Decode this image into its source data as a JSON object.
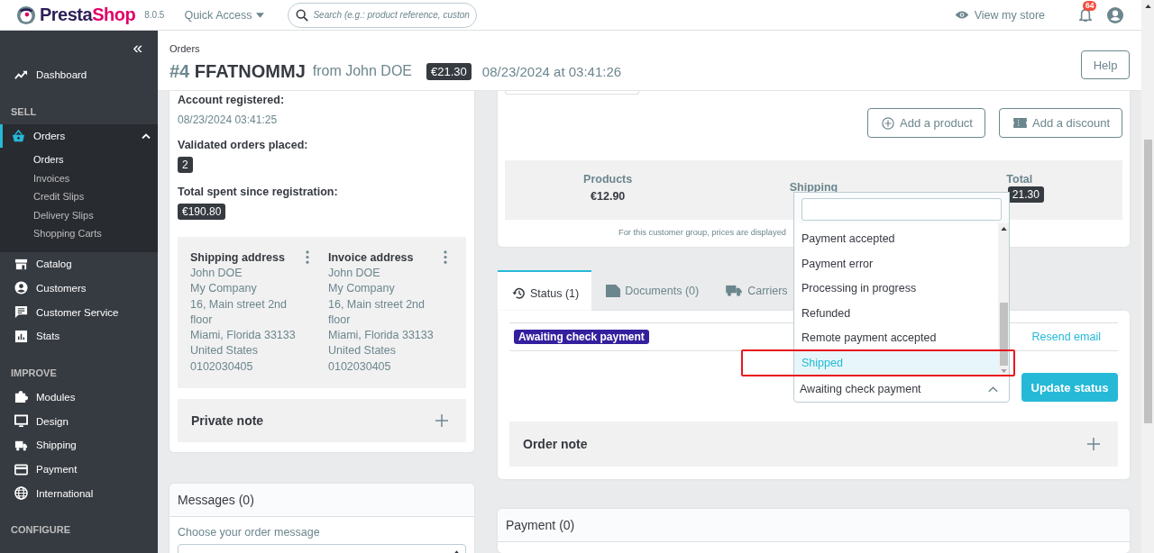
{
  "header": {
    "brand": {
      "first": "Presta",
      "second": "Shop"
    },
    "version": "8.0.5",
    "quick_access": "Quick Access",
    "search": {
      "placeholder": "Search (e.g.: product reference, custon"
    },
    "view_store": "View my store",
    "notifications": "64"
  },
  "sidebar": {
    "collapse": "«",
    "items": [
      {
        "kind": "link",
        "label": "Dashboard",
        "selected": false
      },
      {
        "kind": "heading",
        "label": "SELL"
      },
      {
        "kind": "link",
        "label": "Orders",
        "selected": true,
        "expanded": true,
        "children": [
          {
            "label": "Orders",
            "selected": true
          },
          {
            "label": "Invoices",
            "selected": false
          },
          {
            "label": "Credit Slips",
            "selected": false
          },
          {
            "label": "Delivery Slips",
            "selected": false
          },
          {
            "label": "Shopping Carts",
            "selected": false
          }
        ]
      },
      {
        "kind": "link",
        "label": "Catalog",
        "selected": false
      },
      {
        "kind": "link",
        "label": "Customers",
        "selected": false
      },
      {
        "kind": "link",
        "label": "Customer Service",
        "selected": false
      },
      {
        "kind": "link",
        "label": "Stats",
        "selected": false
      },
      {
        "kind": "heading",
        "label": "IMPROVE"
      },
      {
        "kind": "link",
        "label": "Modules",
        "selected": false
      },
      {
        "kind": "link",
        "label": "Design",
        "selected": false
      },
      {
        "kind": "link",
        "label": "Shipping",
        "selected": false
      },
      {
        "kind": "link",
        "label": "Payment",
        "selected": false
      },
      {
        "kind": "link",
        "label": "International",
        "selected": false
      },
      {
        "kind": "heading",
        "label": "CONFIGURE"
      }
    ]
  },
  "page_header": {
    "breadcrumb": "Orders",
    "number": "#4",
    "reference": "FFATNOMMJ",
    "customer": "from John DOE",
    "total": "€21.30",
    "date": "08/23/2024 at 03:41:26",
    "help": "Help"
  },
  "customer": {
    "stats": [
      {
        "label": "Account registered:",
        "value": "08/23/2024 03:41:25",
        "kind": "text"
      },
      {
        "label": "Validated orders placed:",
        "value": "2",
        "kind": "badge"
      },
      {
        "label": "Total spent since registration:",
        "value": "€190.80",
        "kind": "badge"
      }
    ],
    "addresses": [
      {
        "title": "Shipping address",
        "lines": [
          "John DOE",
          "My Company",
          "16, Main street 2nd floor",
          "Miami, Florida 33133",
          "United States",
          "0102030405"
        ]
      },
      {
        "title": "Invoice address",
        "lines": [
          "John DOE",
          "My Company",
          "16, Main street 2nd floor",
          "Miami, Florida 33133",
          "United States",
          "0102030405"
        ]
      }
    ],
    "private_note": "Private note"
  },
  "messages": {
    "title": "Messages (0)",
    "label": "Choose your order message"
  },
  "order": {
    "buttons": [
      "Add a product",
      "Add a discount"
    ],
    "summary": [
      {
        "label": "Products",
        "value": "€12.90",
        "kind": "plain"
      },
      {
        "label": "Shipping",
        "kind": "hidden"
      },
      {
        "label": "Total",
        "value": "21.30",
        "kind": "badge"
      }
    ],
    "note": "For this customer group, prices are displayed"
  },
  "tabs": [
    {
      "label": "Status (1)",
      "selected": true
    },
    {
      "label": "Documents (0)",
      "selected": false
    },
    {
      "label": "Carriers",
      "selected": false
    }
  ],
  "status": {
    "history": [
      {
        "status": "Awaiting check payment",
        "color": "#34209e",
        "action": "Resend email"
      }
    ],
    "select": {
      "value": "Awaiting check payment",
      "expanded": true,
      "options": [
        {
          "label": "Payment accepted",
          "selected": false,
          "annotated": false
        },
        {
          "label": "Payment error",
          "selected": false,
          "annotated": false
        },
        {
          "label": "Processing in progress",
          "selected": false,
          "annotated": false
        },
        {
          "label": "Refunded",
          "selected": false,
          "annotated": false
        },
        {
          "label": "Remote payment accepted",
          "selected": false,
          "annotated": false
        },
        {
          "label": "Shipped",
          "selected": true,
          "annotated": true
        }
      ]
    },
    "button": "Update status",
    "order_note": "Order note"
  },
  "payment": {
    "title": "Payment (0)"
  }
}
